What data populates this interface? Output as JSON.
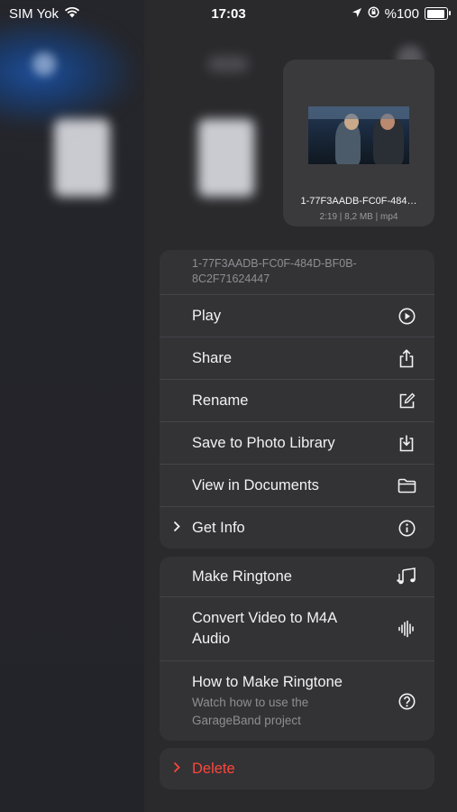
{
  "status_bar": {
    "carrier": "SIM Yok",
    "time": "17:03",
    "battery": "%100",
    "battery_level": 1.0
  },
  "preview": {
    "file_name": "1-77F3AADB-FC0F-484…",
    "meta": "2:19 | 8,2 MB | mp4"
  },
  "menu": {
    "header": "1-77F3AADB-FC0F-484D-BF0B-8C2F71624447",
    "items": [
      {
        "label": "Play",
        "icon": "play-circle-icon"
      },
      {
        "label": "Share",
        "icon": "share-icon"
      },
      {
        "label": "Rename",
        "icon": "edit-icon"
      },
      {
        "label": "Save to Photo Library",
        "icon": "download-icon"
      },
      {
        "label": "View in Documents",
        "icon": "folder-icon"
      },
      {
        "label": "Get Info",
        "icon": "info-icon"
      }
    ],
    "group2": [
      {
        "label": "Make Ringtone",
        "icon": "music-notes-icon"
      },
      {
        "label": "Convert Video to M4A Audio",
        "icon": "waveform-icon"
      },
      {
        "label": "How to Make Ringtone",
        "sub": "Watch how to use the GarageBand project",
        "icon": "help-icon"
      }
    ],
    "delete": "Delete"
  },
  "colors": {
    "destructive": "#ff453a",
    "menu_bg": "#333336"
  }
}
